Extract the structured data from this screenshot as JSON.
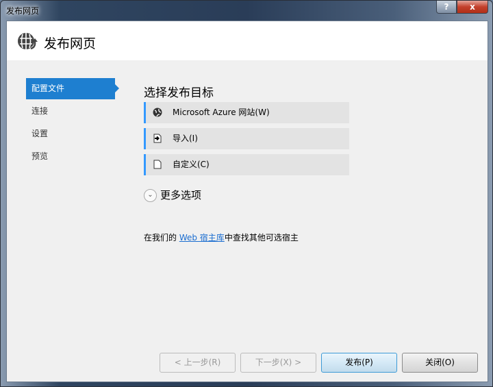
{
  "window": {
    "title": "发布网页",
    "help_label": "?",
    "close_label": "x"
  },
  "header": {
    "title": "发布网页",
    "icon": "globe-publish-icon"
  },
  "sidebar": {
    "items": [
      {
        "label": "配置文件",
        "selected": true
      },
      {
        "label": "连接"
      },
      {
        "label": "设置"
      },
      {
        "label": "预览"
      }
    ]
  },
  "main": {
    "heading": "选择发布目标",
    "options": [
      {
        "label": "Microsoft Azure 网站(W)",
        "icon": "azure-globe-icon"
      },
      {
        "label": "导入(I)",
        "icon": "import-icon"
      },
      {
        "label": "自定义(C)",
        "icon": "document-icon"
      }
    ],
    "more_options": "更多选项",
    "find_prefix": "在我们的 ",
    "find_link": "Web 宿主库",
    "find_suffix": "中查找其他可选宿主"
  },
  "buttons": {
    "prev": "< 上一步(R)",
    "next": "下一步(X) >",
    "publish": "发布(P)",
    "close": "关闭(O)"
  },
  "colors": {
    "accent": "#1e7fd0",
    "option_bar": "#3399ff"
  }
}
